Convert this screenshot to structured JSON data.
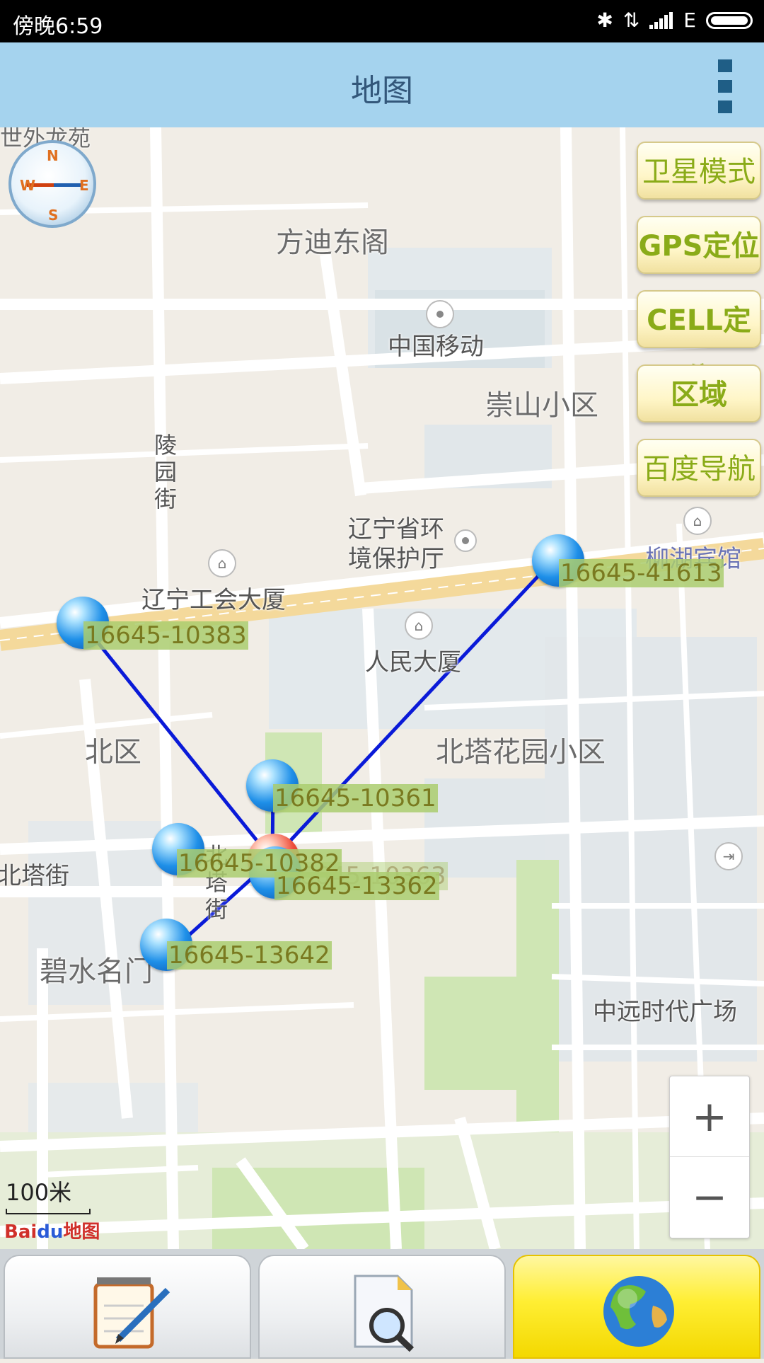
{
  "status_bar": {
    "time": "傍晚6:59",
    "network": "E"
  },
  "app_bar": {
    "title": "地图"
  },
  "side_buttons": [
    {
      "label": "卫星模式"
    },
    {
      "label": "GPS定位"
    },
    {
      "label": "CELL定位"
    },
    {
      "label": "区域CELL"
    },
    {
      "label": "百度导航"
    }
  ],
  "map_labels": {
    "fangdi": "方迪东阁",
    "top_partial": "世外龙苑",
    "china_mobile": "中国移动",
    "chongshan": "崇山小区",
    "lingyuan": "陵园街",
    "liaoning_env": "辽宁省环",
    "liaoning_env2": "境保护厅",
    "liuhu": "柳湖宾馆",
    "gonghui": "辽宁工会大厦",
    "renmin": "人民大厦",
    "beiqu": "北区",
    "beita_garden": "北塔花园小区",
    "beita_jie_left": "北塔街",
    "beita_jie_v": "北塔街",
    "bishui": "碧水名门",
    "zhongyuan": "中远时代广场"
  },
  "cells": [
    {
      "id": "16645-41613"
    },
    {
      "id": "16645-10383"
    },
    {
      "id": "16645-10361"
    },
    {
      "id": "16645-10382"
    },
    {
      "id": "16645-10363"
    },
    {
      "id": "16645-13362"
    },
    {
      "id": "16645-13642"
    }
  ],
  "compass": {
    "n": "N",
    "s": "S",
    "e": "E",
    "w": "W"
  },
  "scale": {
    "label": "100米"
  },
  "baidu_logo": {
    "bai": "Bai",
    "du": "du",
    "map": "地图"
  },
  "zoom": {
    "plus": "+",
    "minus": "−"
  }
}
